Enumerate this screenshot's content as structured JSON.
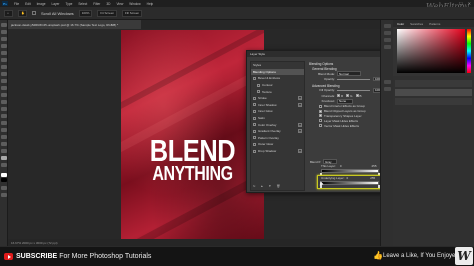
{
  "window": {
    "app_logo": "Ps",
    "menus": [
      "File",
      "Edit",
      "Image",
      "Layer",
      "Type",
      "Select",
      "Filter",
      "3D",
      "View",
      "Window",
      "Help"
    ],
    "controls": [
      "–",
      "☐",
      "✕"
    ]
  },
  "options_bar": {
    "items": [
      "Scroll All Windows",
      "100%",
      "Fit Screen",
      "Fill Screen"
    ]
  },
  "document": {
    "tab_title": "jackson-david-y52RRZC45-unsplash.psd @ 16.7% (Sample Text Logo, RGB/8) *",
    "status": "16.67%   2000 px x 3000 px (72 ppi)"
  },
  "watermark": "WebFlippy",
  "poster": {
    "line1": "BLEND",
    "line2": "ANYTHING"
  },
  "layer_style": {
    "title": "Layer Style",
    "close_icon": "close-icon",
    "styles_header": "Styles",
    "styles": [
      {
        "label": "Blending Options",
        "header": true
      },
      {
        "label": "Bevel & Emboss",
        "check": true
      },
      {
        "label": "Contour",
        "check": true,
        "indent": true
      },
      {
        "label": "Texture",
        "check": true,
        "indent": true
      },
      {
        "label": "Stroke",
        "check": true,
        "plus": true
      },
      {
        "label": "Inner Shadow",
        "check": true,
        "plus": true
      },
      {
        "label": "Inner Glow",
        "check": true
      },
      {
        "label": "Satin",
        "check": true
      },
      {
        "label": "Color Overlay",
        "check": true,
        "plus": true
      },
      {
        "label": "Gradient Overlay",
        "check": true,
        "plus": true
      },
      {
        "label": "Pattern Overlay",
        "check": true
      },
      {
        "label": "Outer Glow",
        "check": true
      },
      {
        "label": "Drop Shadow",
        "check": true,
        "plus": true
      }
    ],
    "blending_options": {
      "section_title": "Blending Options",
      "general_title": "General Blending",
      "blend_mode_label": "Blend Mode:",
      "blend_mode_value": "Normal",
      "opacity_label": "Opacity:",
      "opacity_value": "100",
      "opacity_unit": "%",
      "advanced_title": "Advanced Blending",
      "fill_opacity_label": "Fill Opacity:",
      "fill_opacity_value": "100",
      "channels_label": "Channels:",
      "channels": [
        "R",
        "G",
        "B"
      ],
      "knockout_label": "Knockout:",
      "knockout_value": "None",
      "checks": [
        {
          "label": "Blend Interior Effects as Group",
          "on": false
        },
        {
          "label": "Blend Clipped Layers as Group",
          "on": true
        },
        {
          "label": "Transparency Shapes Layer",
          "on": true
        },
        {
          "label": "Layer Mask Hides Effects",
          "on": false
        },
        {
          "label": "Vector Mask Hides Effects",
          "on": false
        }
      ],
      "blend_if_label": "Blend If:",
      "blend_if_value": "Gray",
      "this_layer_label": "This Layer:",
      "this_layer_values": [
        "0",
        "255"
      ],
      "underlying_label": "Underlying Layer:",
      "underlying_values": [
        "0",
        "255"
      ]
    },
    "buttons": {
      "ok": "OK",
      "cancel": "Cancel",
      "new_style": "New Style...",
      "preview_label": "Preview"
    }
  },
  "right_panel": {
    "tabs": [
      "Color",
      "Swatches",
      "Patterns"
    ],
    "picker_color": "#e3001b"
  },
  "banner": {
    "subscribe_bold": "SUBSCRIBE",
    "subscribe_rest": "For More Photoshop Tutorials",
    "like_text": "Leave a Like, If You Enjoyed!",
    "like_icon": "thumbs-up-icon",
    "logo_letter": "W"
  },
  "colors": {
    "accent": "#31a8ff",
    "highlight": "#c9c920",
    "youtube": "#e01b1b"
  }
}
